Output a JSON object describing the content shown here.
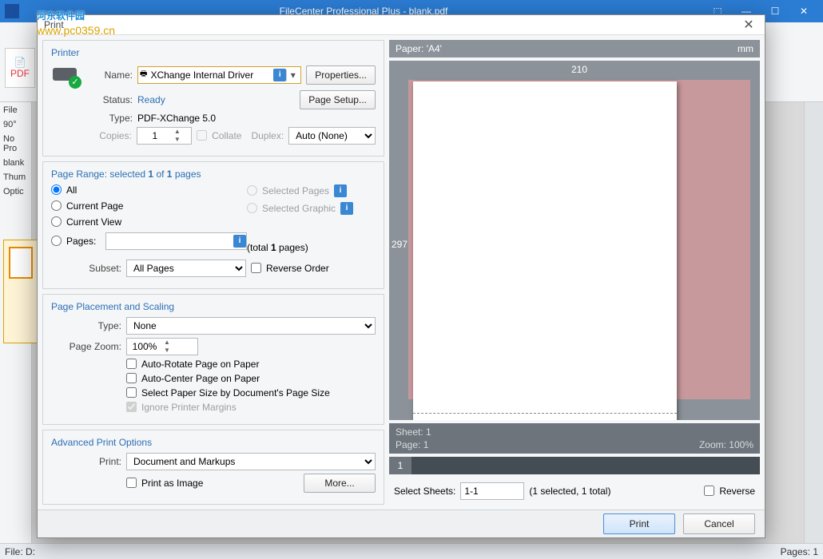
{
  "app": {
    "title": "FileCenter Professional Plus - blank.pdf"
  },
  "watermark": {
    "line1": "河东软件园",
    "line2": "www.pc0359.cn"
  },
  "bg": {
    "pdf_btn": "PDF",
    "file_tab": "File",
    "noproof": "No Pro",
    "blank_tab": "blank",
    "thum": "Thum",
    "optic": "Optic"
  },
  "statusbar": {
    "left": "File: D:",
    "pages": "Pages: 1"
  },
  "dialog": {
    "title": "Print",
    "printer": {
      "header": "Printer",
      "name_lbl": "Name:",
      "name_val": "XChange Internal Driver",
      "props_btn": "Properties...",
      "status_lbl": "Status:",
      "status_val": "Ready",
      "pagesetup_btn": "Page Setup...",
      "type_lbl": "Type:",
      "type_val": "PDF-XChange 5.0",
      "copies_lbl": "Copies:",
      "copies_val": "1",
      "collate_lbl": "Collate",
      "duplex_lbl": "Duplex:",
      "duplex_val": "Auto (None)"
    },
    "range": {
      "header_a": "Page Range: selected ",
      "header_b": "1",
      "header_c": " of ",
      "header_d": "1",
      "header_e": " pages",
      "all": "All",
      "current_page": "Current Page",
      "current_view": "Current View",
      "pages_lbl": "Pages:",
      "total_a": "(total ",
      "total_b": "1",
      "total_c": " pages)",
      "selected_pages": "Selected Pages",
      "selected_graphic": "Selected Graphic",
      "subset_lbl": "Subset:",
      "subset_val": "All Pages",
      "reverse": "Reverse Order"
    },
    "placement": {
      "header": "Page Placement and Scaling",
      "type_lbl": "Type:",
      "type_val": "None",
      "zoom_lbl": "Page Zoom:",
      "zoom_val": "100%",
      "auto_rotate": "Auto-Rotate Page on Paper",
      "auto_center": "Auto-Center Page on Paper",
      "paper_size": "Select Paper Size by Document's Page Size",
      "ignore_margins": "Ignore Printer Margins"
    },
    "advanced": {
      "header": "Advanced Print Options",
      "print_lbl": "Print:",
      "print_val": "Document and Markups",
      "print_image": "Print as Image",
      "more_btn": "More..."
    },
    "preview": {
      "paper_lbl": "Paper: 'A4'",
      "unit": "mm",
      "width": "210",
      "height": "297",
      "sheet": "Sheet: 1",
      "page": "Page: 1",
      "zoom": "Zoom: 100%",
      "tab": "1",
      "select_lbl": "Select Sheets:",
      "select_val": "1-1",
      "select_note": "(1 selected, 1 total)",
      "reverse": "Reverse"
    },
    "buttons": {
      "print": "Print",
      "cancel": "Cancel"
    }
  }
}
